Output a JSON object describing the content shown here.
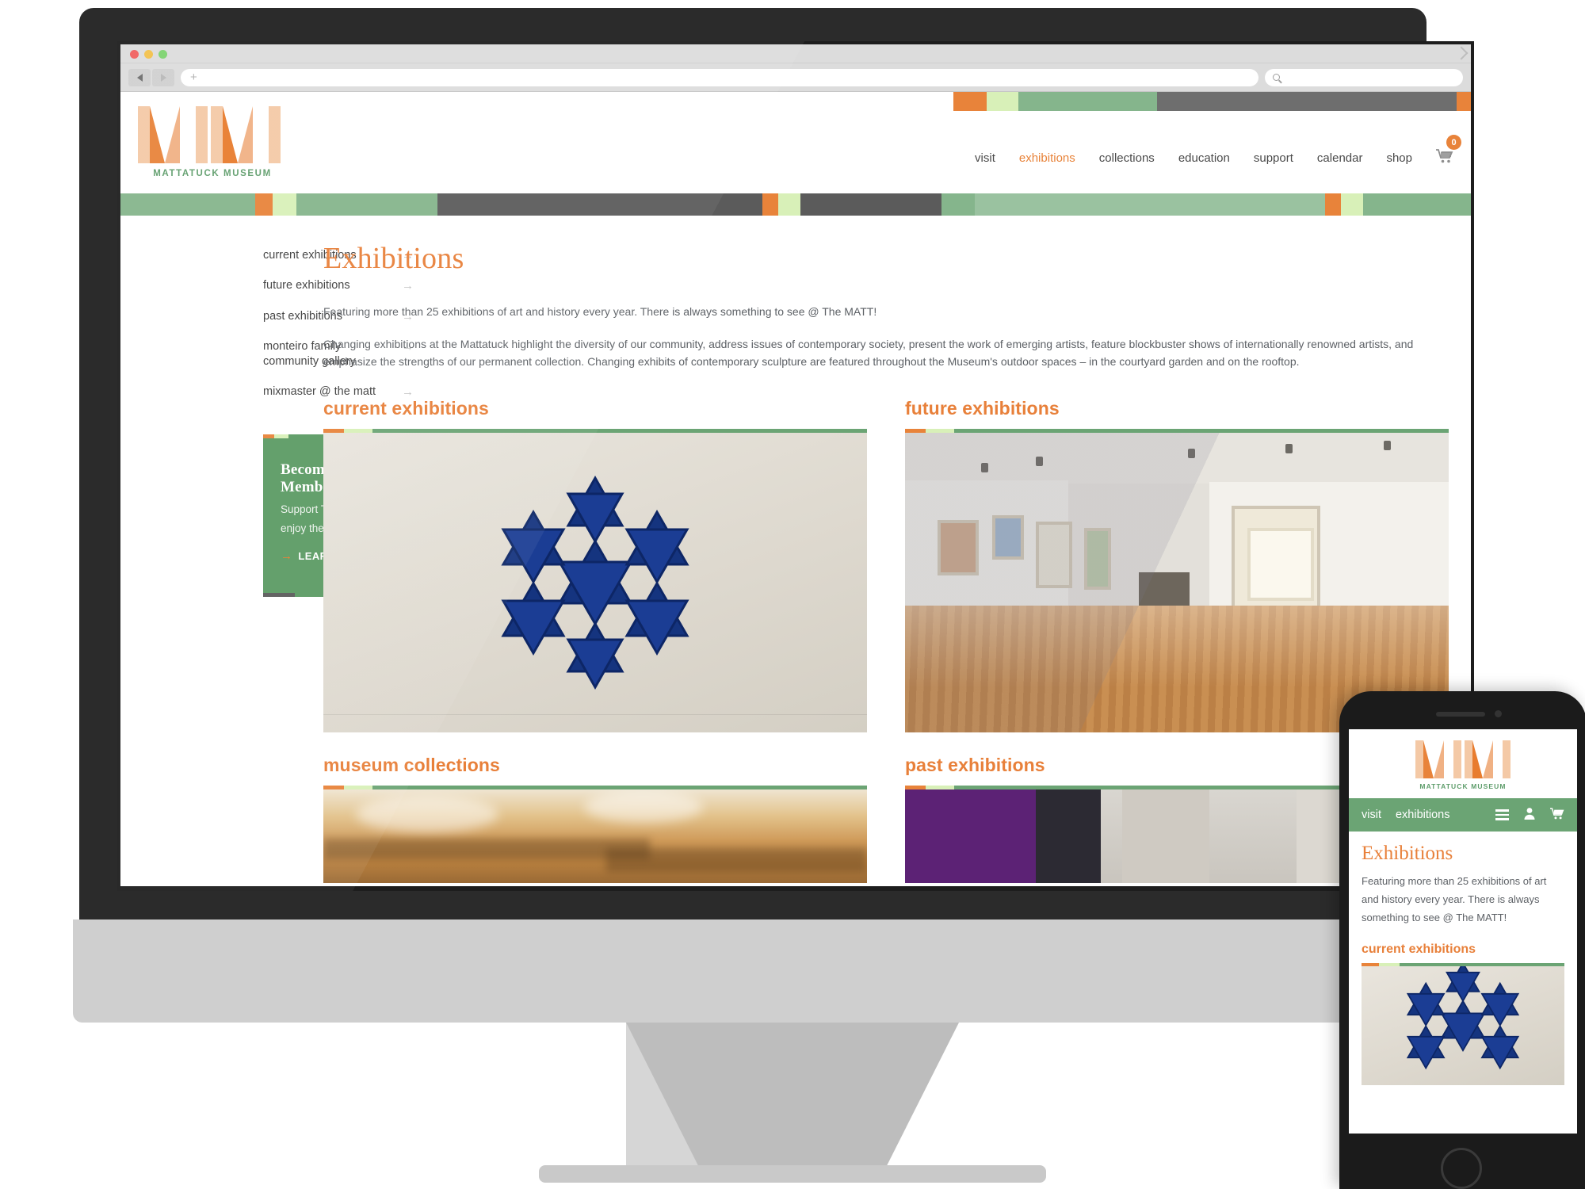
{
  "browser": {
    "url_placeholder": "",
    "search_placeholder": "",
    "new_tab_label": "+",
    "back_label": "◀",
    "forward_label": "▶"
  },
  "site": {
    "logo_caption": "MATTATUCK MUSEUM",
    "nav": [
      {
        "label": "visit",
        "active": false
      },
      {
        "label": "exhibitions",
        "active": true
      },
      {
        "label": "collections",
        "active": false
      },
      {
        "label": "education",
        "active": false
      },
      {
        "label": "support",
        "active": false
      },
      {
        "label": "calendar",
        "active": false
      },
      {
        "label": "shop",
        "active": false
      }
    ],
    "cart_count": "0",
    "cart_icon": "🛒"
  },
  "sidebar": {
    "items": [
      {
        "label": "current exhibitions",
        "arrow": "→"
      },
      {
        "label": "future exhibitions",
        "arrow": "→"
      },
      {
        "label": "past exhibitions",
        "arrow": "→"
      },
      {
        "label": "monteiro family community gallery",
        "arrow": "→"
      },
      {
        "label": "mixmaster @ the matt",
        "arrow": "→"
      }
    ],
    "member_card": {
      "title": "Become a Member",
      "subtitle": "Support The MATT and enjoy the benefits",
      "cta_label": "LEARN MORE",
      "cta_arrow": "→"
    }
  },
  "main": {
    "title": "Exhibitions",
    "intro_paragraph_1": "Featuring more than 25 exhibitions of art and history every year. There is always something to see @ The MATT!",
    "intro_paragraph_2": "Changing exhibitions at the Mattatuck highlight the diversity of our community, address issues of contemporary society, present the work of emerging artists, feature blockbuster shows of internationally renowned artists, and emphasize the strengths of our permanent collection. Changing exhibits of contemporary sculpture are featured throughout the Museum's outdoor spaces – in the courtyard garden and on the rooftop.",
    "cards": [
      {
        "title": "current exhibitions"
      },
      {
        "title": "future exhibitions"
      },
      {
        "title": "museum collections"
      },
      {
        "title": "past exhibitions"
      }
    ]
  },
  "mobile": {
    "logo_caption": "MATTATUCK MUSEUM",
    "nav": [
      {
        "label": "visit"
      },
      {
        "label": "exhibitions"
      }
    ],
    "menu_icon": "menu-icon",
    "account_icon": "👤",
    "cart_icon": "🛒",
    "title": "Exhibitions",
    "intro": "Featuring more than 25 exhibitions of art and history every year. There is always something to see @ The MATT!",
    "card_title": "current exhibitions"
  },
  "colors": {
    "orange": "#e8803a",
    "green": "#6ba474",
    "light_green": "#d8f0b8",
    "dark_gray": "#5b5b5b",
    "card_green": "#5b9a63",
    "logo_green": "#5e9d6b",
    "text_gray": "#5d6166",
    "blue_art": "#11328c"
  }
}
